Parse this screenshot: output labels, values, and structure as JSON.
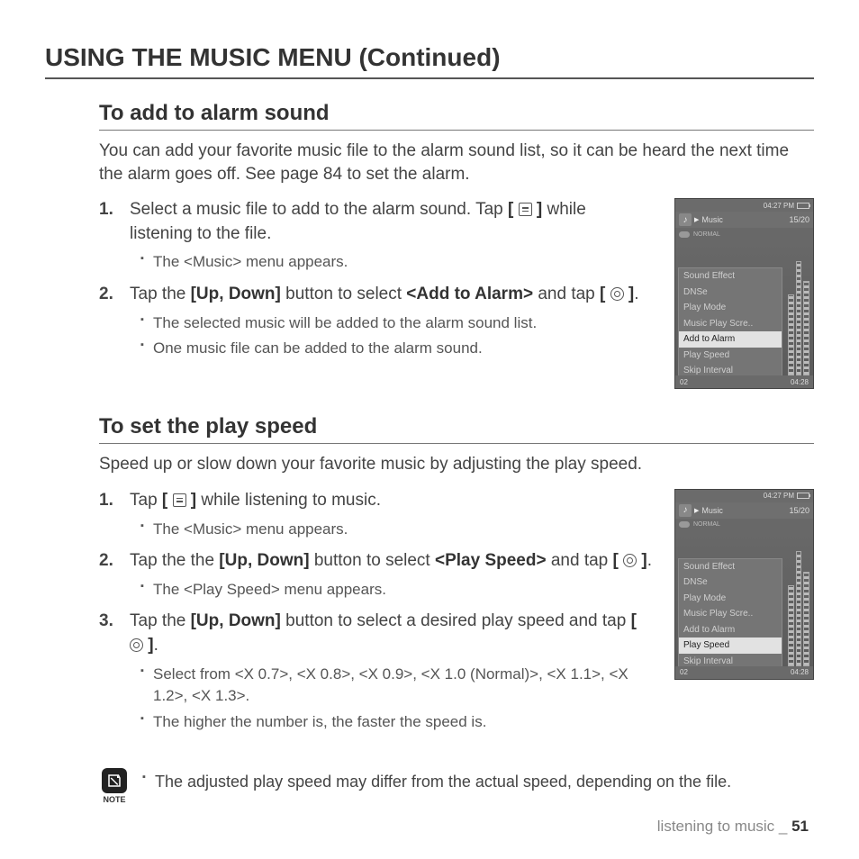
{
  "page_title": "USING THE MUSIC MENU (Continued)",
  "section1": {
    "heading": "To add to alarm sound",
    "intro": "You can add your favorite music file to the alarm sound list, so it can be heard the next time the alarm goes off. See page 84 to set the alarm.",
    "step1_a": "Select a music file to add to the alarm sound. Tap ",
    "step1_b": " while listening to the file.",
    "step1_sub1": "The <Music> menu appears.",
    "step2_a": "Tap the ",
    "step2_b": "[Up, Down]",
    "step2_c": " button to select ",
    "step2_d": "<Add to Alarm>",
    "step2_e": " and tap ",
    "step2_sub1": "The selected music will be added to the alarm sound list.",
    "step2_sub2": "One music file can be added to the alarm sound."
  },
  "section2": {
    "heading": "To set the play speed",
    "intro": "Speed up or slow down your favorite music by adjusting the play speed.",
    "step1_a": "Tap ",
    "step1_b": " while listening to music.",
    "step1_sub1": "The <Music> menu appears.",
    "step2_a": "Tap the the ",
    "step2_b": "[Up, Down]",
    "step2_c": " button to select ",
    "step2_d": "<Play Speed>",
    "step2_e": " and tap ",
    "step2_sub1": "The <Play Speed> menu appears.",
    "step3_a": "Tap the ",
    "step3_b": "[Up, Down]",
    "step3_c": " button to select a desired play speed and tap ",
    "step3_sub1": "Select from <X 0.7>, <X 0.8>, <X 0.9>, <X 1.0 (Normal)>, <X 1.1>, <X 1.2>, <X 1.3>.",
    "step3_sub2": "The higher the number is, the faster the speed is.",
    "note": "The adjusted play speed may differ from the actual speed, depending on the file.",
    "note_label": "NOTE"
  },
  "device": {
    "clock": "04:27 PM",
    "title": "Music",
    "counter": "15/20",
    "mode": "NORMAL",
    "menu": [
      "Sound Effect",
      "DNSe",
      "Play Mode",
      "Music Play Scre..",
      "Add to Alarm",
      "Play Speed",
      "Skip Interval"
    ],
    "sel1": "Add to Alarm",
    "sel2": "Play Speed",
    "time_left": "02",
    "time_right": "04:28"
  },
  "footer_section": "listening to music _ ",
  "footer_page": "51"
}
